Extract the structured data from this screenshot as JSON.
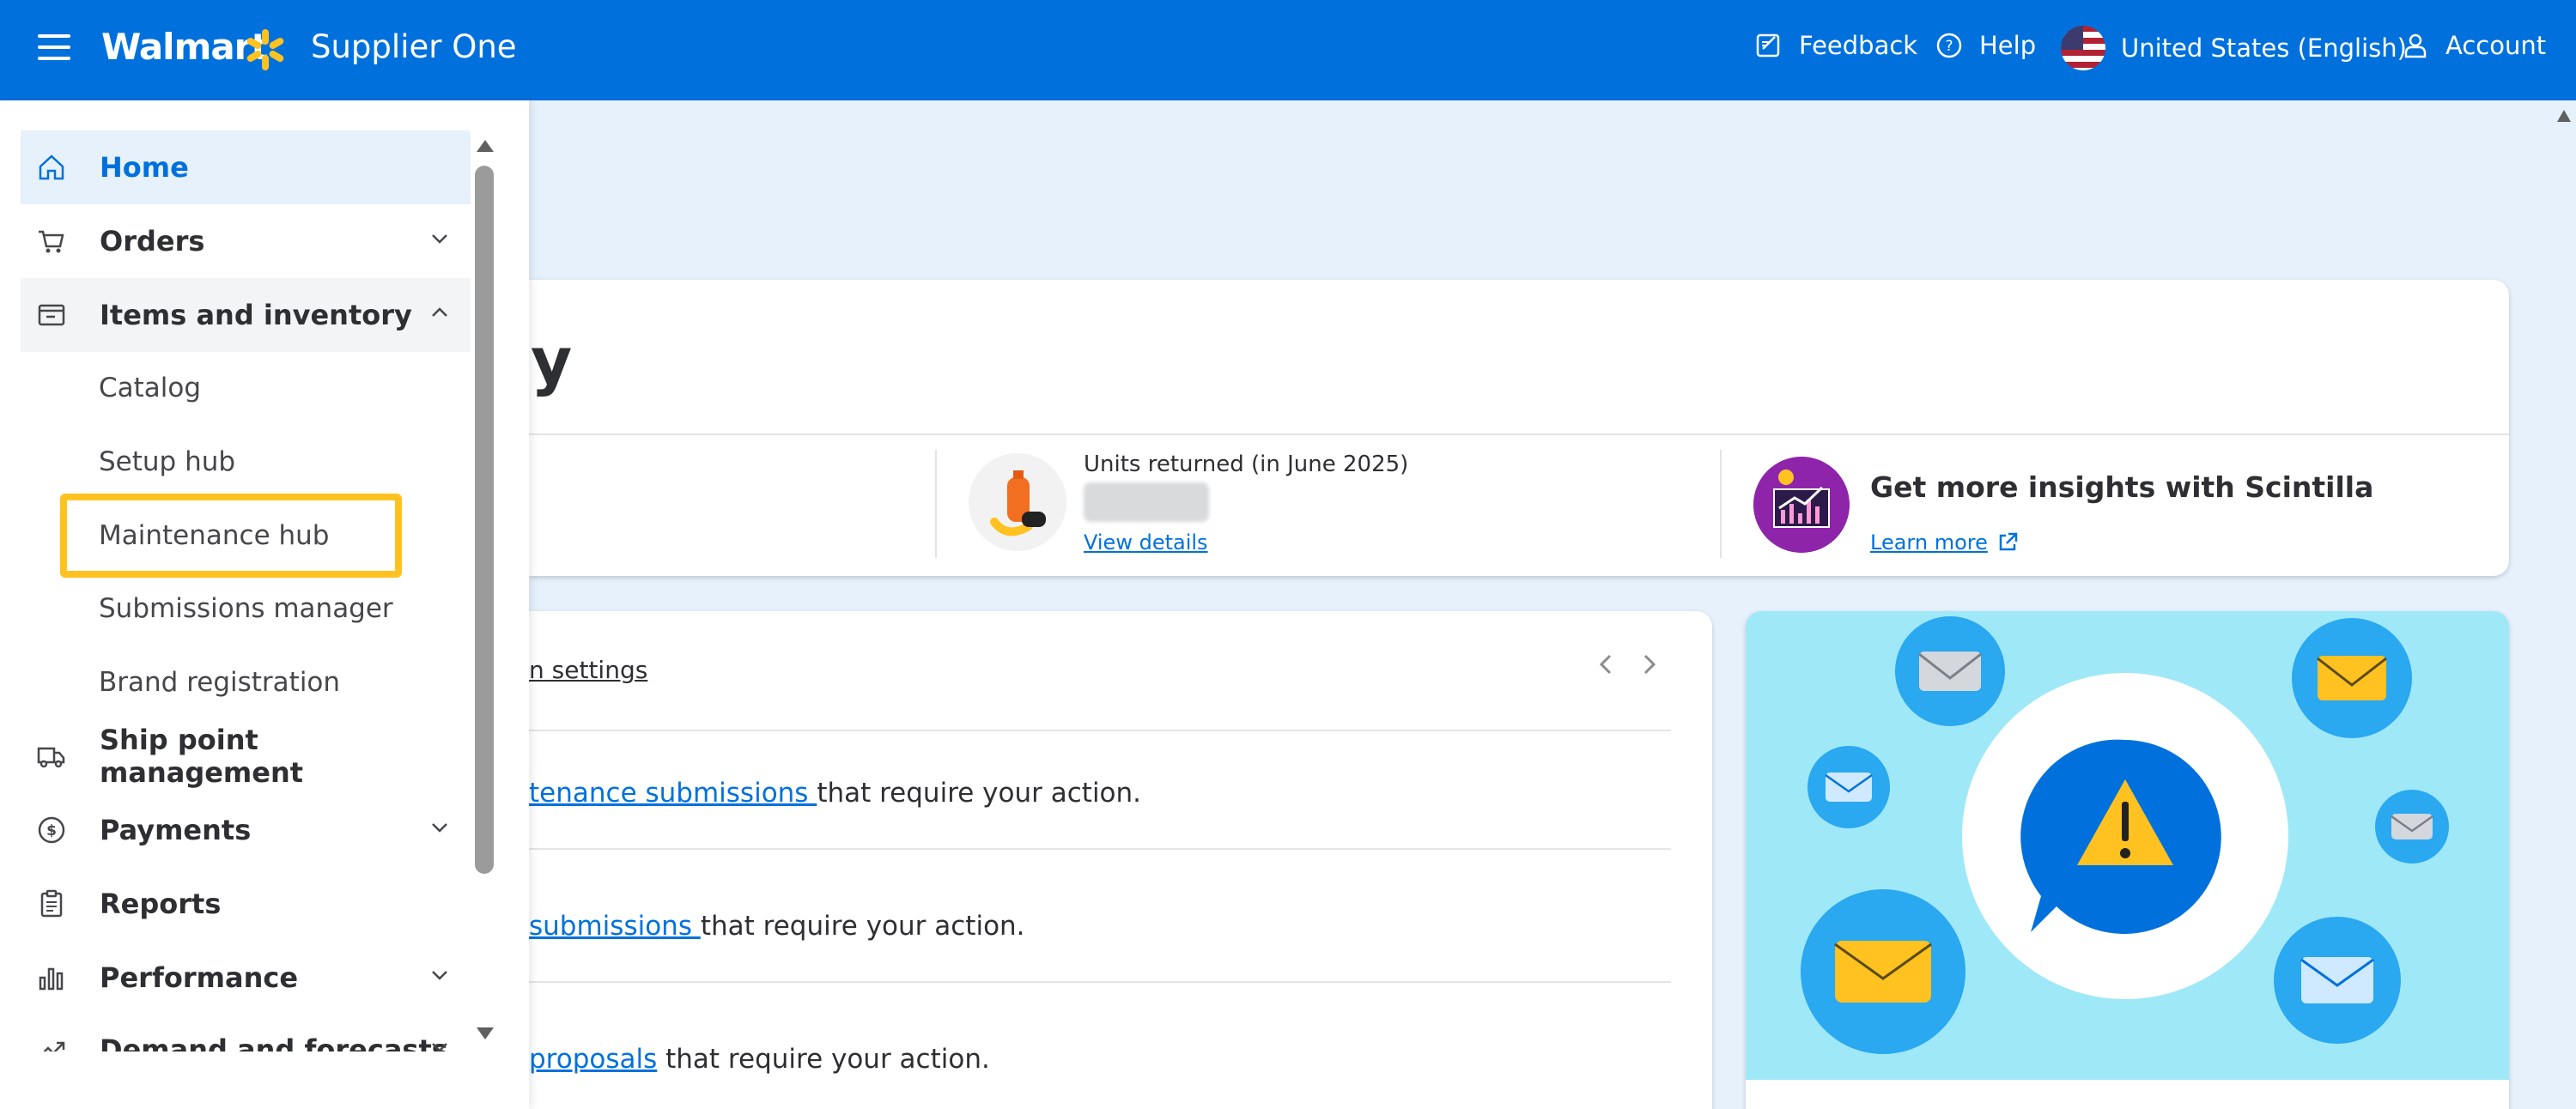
{
  "header": {
    "brand": "Walmart",
    "product": "Supplier One",
    "feedback": "Feedback",
    "help": "Help",
    "locale": "United States (English)",
    "account": "Account",
    "bg_color": "#0071dc"
  },
  "sidebar": {
    "items": [
      {
        "label": "Home",
        "icon": "home-icon",
        "state": "active"
      },
      {
        "label": "Orders",
        "icon": "cart-icon",
        "chevron": "down"
      },
      {
        "label": "Items and inventory",
        "icon": "inventory-icon",
        "chevron": "up",
        "state": "expanded"
      },
      {
        "label": "Ship point management",
        "icon": "truck-icon"
      },
      {
        "label": "Payments",
        "icon": "dollar-icon",
        "chevron": "down"
      },
      {
        "label": "Reports",
        "icon": "clipboard-icon"
      },
      {
        "label": "Performance",
        "icon": "bar-chart-icon",
        "chevron": "down"
      },
      {
        "label": "Demand and forecasts",
        "icon": "trend-icon",
        "chevron": "down"
      }
    ],
    "subitems": [
      "Catalog",
      "Setup hub",
      "Maintenance hub",
      "Submissions manager",
      "Brand registration"
    ],
    "highlight_color": "#ffc220"
  },
  "main": {
    "heading_fragment": "y",
    "metric": {
      "title": "Units returned (in June 2025)",
      "link": "View details"
    },
    "scintilla": {
      "title": "Get more insights with Scintilla",
      "link": "Learn more"
    },
    "tasks": {
      "settings_link": "n settings",
      "lines": [
        {
          "link": "tenance submissions ",
          "text": "that require your action."
        },
        {
          "link": "submissions ",
          "text": "that require your action."
        },
        {
          "link": "proposals",
          "text": " that require your action."
        }
      ]
    }
  }
}
